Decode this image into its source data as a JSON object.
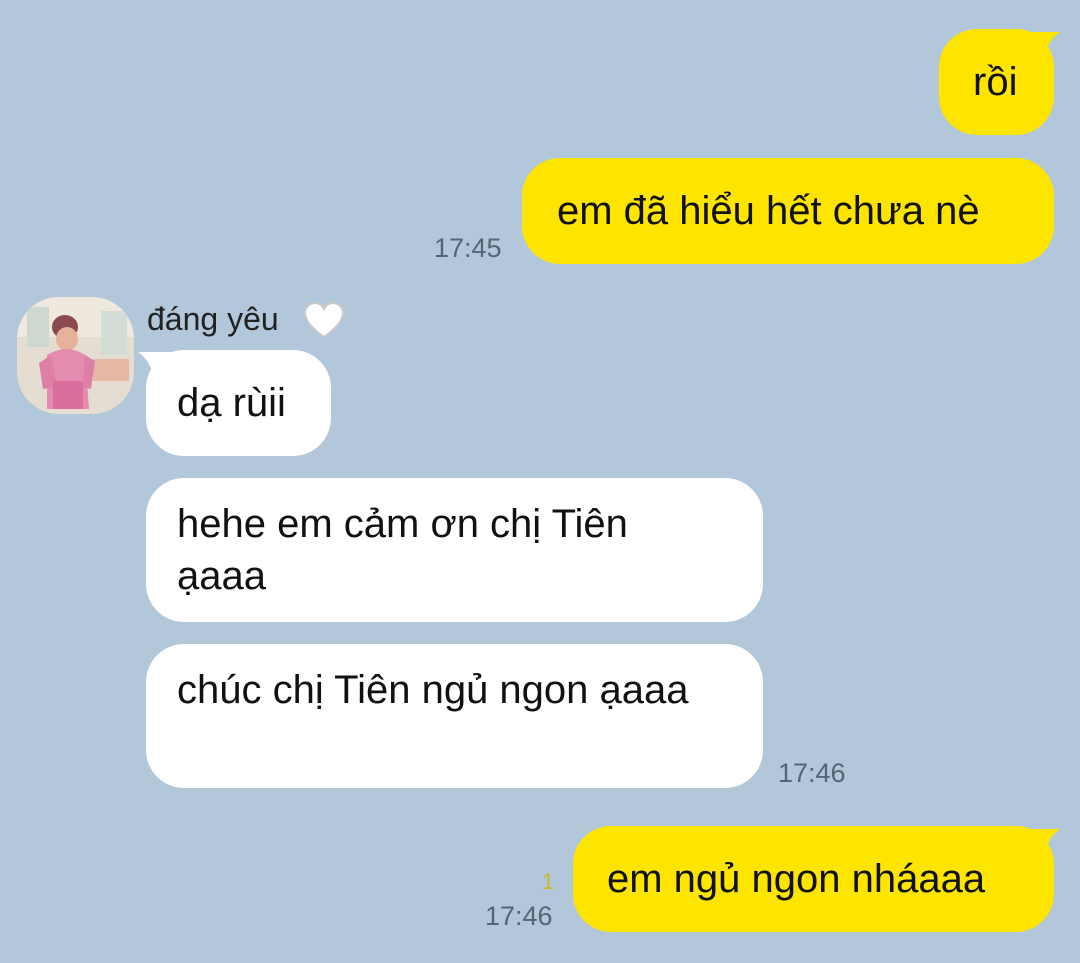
{
  "colors": {
    "background": "#b2c7da",
    "outgoing_bubble": "#fee500",
    "incoming_bubble": "#ffffff",
    "timestamp": "#556575",
    "unread_count": "#c9b827"
  },
  "messages": {
    "m1": {
      "direction": "outgoing",
      "text": "rồi"
    },
    "m2": {
      "direction": "outgoing",
      "text": "em đã hiểu hết chưa nè",
      "time": "17:45"
    },
    "m3": {
      "direction": "incoming",
      "text": "dạ rùii"
    },
    "m4": {
      "direction": "incoming",
      "text": "hehe em cảm ơn chị Tiên ạaaa"
    },
    "m5": {
      "direction": "incoming",
      "text": "chúc chị Tiên ngủ ngon ạaaa",
      "time": "17:46"
    },
    "m6": {
      "direction": "outgoing",
      "text": "em ngủ ngon nháaaa",
      "time": "17:46",
      "unread": "1"
    }
  },
  "contact": {
    "name": "đáng yêu",
    "name_icon": "white-heart-icon",
    "avatar_icon": "profile-photo"
  }
}
